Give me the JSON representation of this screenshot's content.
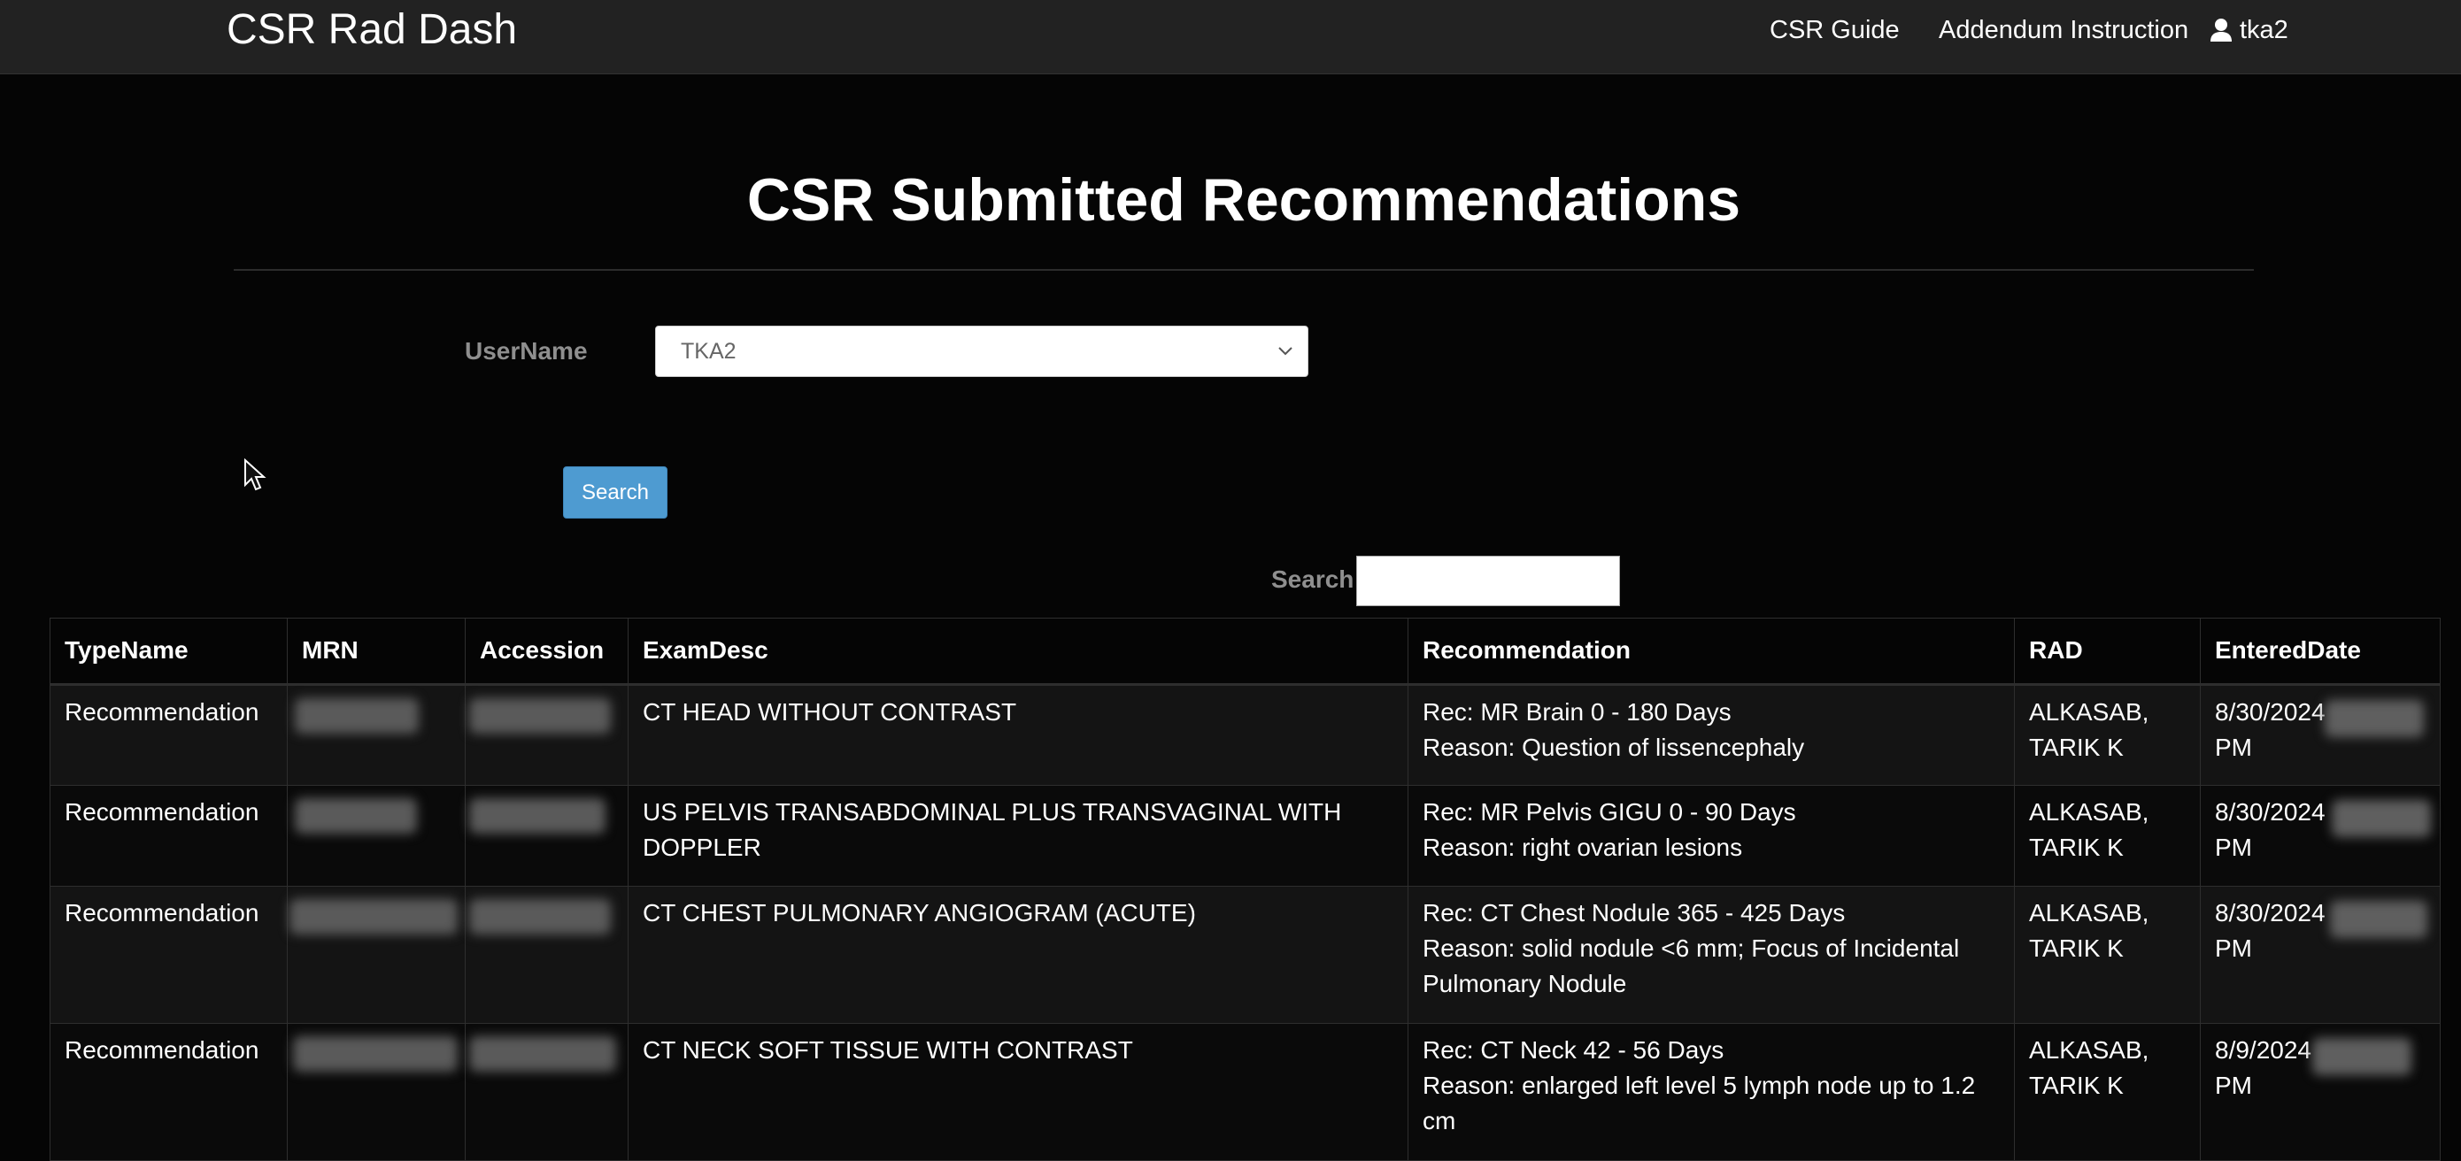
{
  "navbar": {
    "brand": "CSR Rad Dash",
    "links": [
      "CSR Guide",
      "Addendum Instruction"
    ],
    "user": "tka2",
    "user_icon": "user-icon"
  },
  "page": {
    "title": "CSR Submitted Recommendations"
  },
  "form": {
    "username_label": "UserName",
    "username_value": "TKA2",
    "search_button": "Search",
    "filter_label": "Search:",
    "filter_value": ""
  },
  "table": {
    "headers": [
      "TypeName",
      "MRN",
      "Accession",
      "ExamDesc",
      "Recommendation",
      "RAD",
      "EnteredDate"
    ],
    "rows": [
      {
        "type": "Recommendation",
        "exam": "CT HEAD WITHOUT CONTRAST",
        "rec": "Rec: MR Brain 0 - 180 Days",
        "reason": "Reason: Question of lissencephaly",
        "rad": "ALKASAB, TARIK K",
        "date": "8/30/2024",
        "time_suffix": "PM"
      },
      {
        "type": "Recommendation",
        "exam": "US PELVIS TRANSABDOMINAL PLUS TRANSVAGINAL WITH DOPPLER",
        "rec": "Rec: MR Pelvis GIGU 0 - 90 Days",
        "reason": "Reason: right ovarian lesions",
        "rad": "ALKASAB, TARIK K",
        "date": "8/30/2024",
        "time_suffix": "PM"
      },
      {
        "type": "Recommendation",
        "exam": "CT CHEST PULMONARY ANGIOGRAM (ACUTE)",
        "rec": "Rec: CT Chest Nodule 365 - 425 Days",
        "reason": "Reason: solid nodule <6 mm; Focus of Incidental Pulmonary Nodule",
        "rad": "ALKASAB, TARIK K",
        "date": "8/30/2024",
        "time_suffix": "PM"
      },
      {
        "type": "Recommendation",
        "exam": "CT NECK SOFT TISSUE WITH CONTRAST",
        "rec": "Rec: CT Neck 42 - 56 Days",
        "reason": "Reason: enlarged left level 5 lymph node up to 1.2 cm",
        "rad": "ALKASAB, TARIK K",
        "date": "8/9/2024",
        "time_suffix": "PM"
      }
    ]
  }
}
